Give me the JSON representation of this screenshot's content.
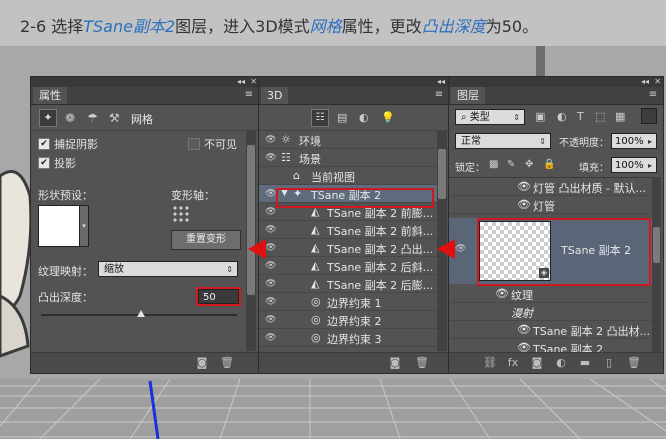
{
  "instruction": {
    "step": "2-6",
    "p1": " 选择",
    "h1": "TSane副本2",
    "p2": "图层，进入3D模式",
    "h2": "网格",
    "p3": "属性，更改",
    "h3": "凸出深度",
    "p4": "为50。"
  },
  "properties": {
    "tab": "属性",
    "mesh_label": "网格",
    "catch_shadow": "捕捉阴影",
    "cast_shadow": "投影",
    "invisible": "不可见",
    "shape_preset": "形状预设：",
    "deform_axis": "变形轴：",
    "reset_deform": "重置变形",
    "texture_map": "纹理映射：",
    "texture_value": "缩放",
    "extrude_depth": "凸出深度：",
    "extrude_value": "50"
  },
  "three_d": {
    "tab": "3D",
    "rows": [
      {
        "label": "环境"
      },
      {
        "label": "场景"
      },
      {
        "label": "当前视图"
      },
      {
        "label": "TSane 副本 2"
      },
      {
        "label": "TSane 副本 2 前膨..."
      },
      {
        "label": "TSane 副本 2 前斜..."
      },
      {
        "label": "TSane 副本 2 凸出..."
      },
      {
        "label": "TSane 副本 2 后斜..."
      },
      {
        "label": "TSane 副本 2 后膨..."
      },
      {
        "label": "边界约束 1"
      },
      {
        "label": "边界约束 2"
      },
      {
        "label": "边界约束 3"
      }
    ]
  },
  "layers": {
    "tab": "图层",
    "filter": "类型",
    "blend_mode": "正常",
    "opacity_label": "不透明度：",
    "opacity_value": "100%",
    "lock_label": "锁定：",
    "fill_label": "填充：",
    "fill_value": "100%",
    "rows": {
      "r1": "灯管 凸出材质 - 默认...",
      "r2": "灯管",
      "selected": "TSane 副本 2",
      "texture": "纹理",
      "diffuse": "漫射",
      "r3": "TSane 副本 2 凸出材...",
      "r4": "TSane 副本 2"
    }
  }
}
